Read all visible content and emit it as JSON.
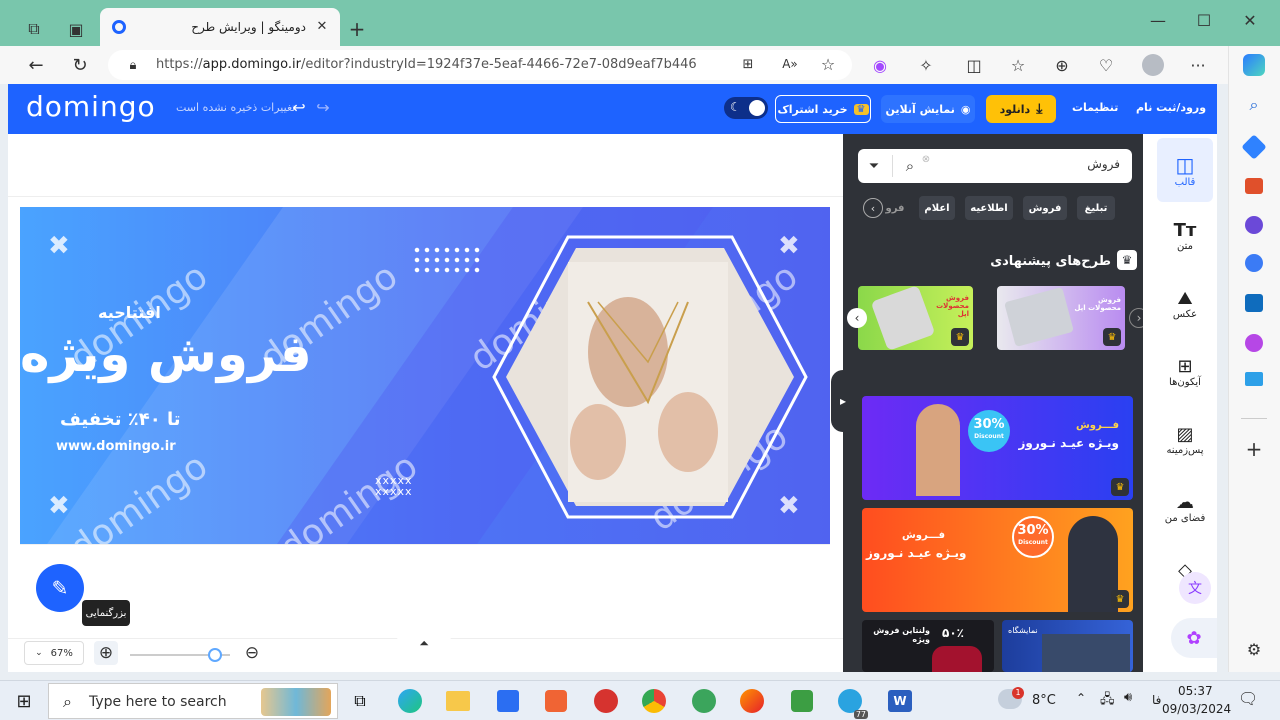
{
  "browser": {
    "tab_title": "دومینگو | ویرایش طرح",
    "url_prefix": "https://",
    "url_host": "app.domingo.ir",
    "url_path": "/editor?industryId=1924f37e-5eaf-4466-72e7-08d9eaf7b446"
  },
  "header": {
    "logo": "domingo",
    "save_status": "تغییرات ذخیره نشده است",
    "subscribe_label": "خرید اشتراک",
    "preview_label": "نمایش آنلاین",
    "download_label": "دانلود",
    "settings_label": "تنظیمات",
    "login_label": "ورود/ثبت نام"
  },
  "banner": {
    "opening": "افتتاحیه",
    "headline": "فروش ویژه",
    "discount": "تا ۴۰٪ تخفیف",
    "website": "www.domingo.ir",
    "watermark": "domingo"
  },
  "zoom": {
    "tooltip": "بزرگنمایی",
    "level": "67%"
  },
  "panel": {
    "search_value": "فروش",
    "chips": [
      "تبلیغ",
      "فروش",
      "اطلاعیه",
      "اعلام",
      "فرو"
    ],
    "suggested_title": "طرح‌های پیشنهادی",
    "suggested_cards": [
      {
        "title": "فروش محصولات اپل"
      },
      {
        "title": "فروش محصولات اپل"
      }
    ],
    "templates": [
      {
        "title": "فـــروش",
        "subtitle": "ویـژه عیـد نـوروز",
        "badge": "30%",
        "badge_sub": "Discount",
        "colors": [
          "#6d2bf5",
          "#2a40f2"
        ]
      },
      {
        "title": "فـــروش",
        "subtitle": "ویـژه عیـد نـوروز",
        "badge": "30%",
        "badge_sub": "Discount",
        "colors": [
          "#ff4d1f",
          "#ffa21f"
        ]
      },
      {
        "title": "ولنتاین فروش ویژه",
        "badge": "۵۰٪"
      },
      {
        "title": "نمایشگاه"
      }
    ]
  },
  "rail": {
    "items": [
      "قالب",
      "متن",
      "عکس",
      "آیکون‌ها",
      "پس‌زمینه",
      "فضای من",
      "ل"
    ]
  },
  "taskbar": {
    "search_placeholder": "Type here to search",
    "temperature": "8°C",
    "lang": "فا",
    "time": "05:37",
    "date": "09/03/2024",
    "notif_count": "1",
    "app_badge": "77"
  }
}
